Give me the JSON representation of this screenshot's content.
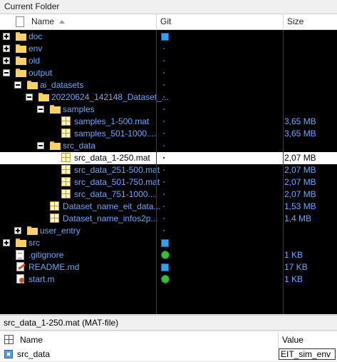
{
  "panel": {
    "title": "Current Folder"
  },
  "columns": {
    "name": "Name",
    "git": "Git",
    "size": "Size"
  },
  "rows": [
    {
      "name": "doc",
      "size": "",
      "git": "square"
    },
    {
      "name": "env",
      "size": "",
      "git": "tiny"
    },
    {
      "name": "old",
      "size": "",
      "git": "tiny"
    },
    {
      "name": "output",
      "size": "",
      "git": "tiny"
    },
    {
      "name": "ai_datasets",
      "size": "",
      "git": "tiny"
    },
    {
      "name": "20220624_142148_Dataset_...",
      "size": "",
      "git": "tiny"
    },
    {
      "name": "samples",
      "size": "",
      "git": "tiny"
    },
    {
      "name": "samples_1-500.mat",
      "size": "3,65 MB",
      "git": "tiny"
    },
    {
      "name": "samples_501-1000....",
      "size": "3,65 MB",
      "git": "tiny"
    },
    {
      "name": "src_data",
      "size": "",
      "git": "tiny"
    },
    {
      "name": "src_data_1-250.mat",
      "size": "2,07 MB",
      "git": "tiny"
    },
    {
      "name": "src_data_251-500.mat",
      "size": "2,07 MB",
      "git": "tiny"
    },
    {
      "name": "src_data_501-750.mat",
      "size": "2,07 MB",
      "git": "tiny"
    },
    {
      "name": "src_data_751-1000....",
      "size": "2,07 MB",
      "git": "tiny"
    },
    {
      "name": "Dataset_name_eit_data...",
      "size": "1,53 MB",
      "git": "tiny"
    },
    {
      "name": "Dataset_name_infos2p...",
      "size": "1,4 MB",
      "git": "tiny"
    },
    {
      "name": "user_entry",
      "size": "",
      "git": "tiny"
    },
    {
      "name": "src",
      "size": "",
      "git": "square"
    },
    {
      "name": ".gitignore",
      "size": "1 KB",
      "git": "dot"
    },
    {
      "name": "README.md",
      "size": "17 KB",
      "git": "square"
    },
    {
      "name": "start.m",
      "size": "1 KB",
      "git": "dot"
    }
  ],
  "details": {
    "title": "src_data_1-250.mat  (MAT-file)",
    "columns": {
      "name": "Name",
      "value": "Value"
    },
    "variable": {
      "name": "src_data",
      "value": "EIT_sim_env"
    }
  }
}
